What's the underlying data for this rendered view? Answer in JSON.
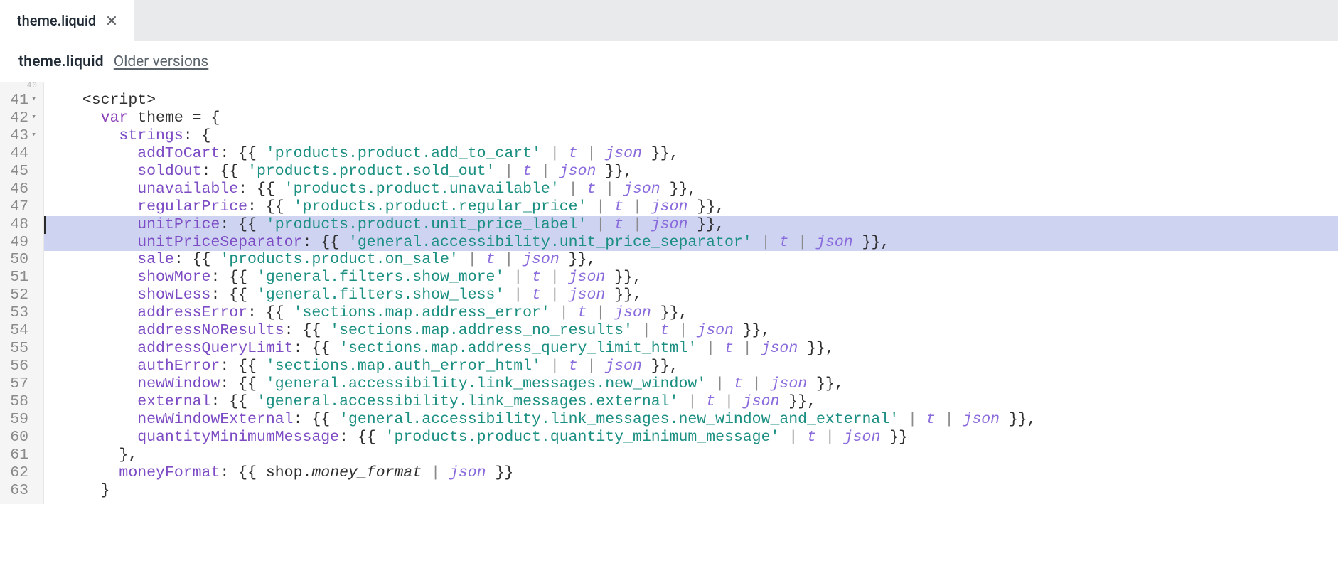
{
  "tab": {
    "label": "theme.liquid"
  },
  "header": {
    "title": "theme.liquid",
    "older_versions": "Older versions"
  },
  "gutter": {
    "ghost_prev": "40",
    "lines": [
      {
        "n": "41",
        "fold": true
      },
      {
        "n": "42",
        "fold": true
      },
      {
        "n": "43",
        "fold": true
      },
      {
        "n": "44",
        "fold": false
      },
      {
        "n": "45",
        "fold": false
      },
      {
        "n": "46",
        "fold": false
      },
      {
        "n": "47",
        "fold": false
      },
      {
        "n": "48",
        "fold": false
      },
      {
        "n": "49",
        "fold": false
      },
      {
        "n": "50",
        "fold": false
      },
      {
        "n": "51",
        "fold": false
      },
      {
        "n": "52",
        "fold": false
      },
      {
        "n": "53",
        "fold": false
      },
      {
        "n": "54",
        "fold": false
      },
      {
        "n": "55",
        "fold": false
      },
      {
        "n": "56",
        "fold": false
      },
      {
        "n": "57",
        "fold": false
      },
      {
        "n": "58",
        "fold": false
      },
      {
        "n": "59",
        "fold": false
      },
      {
        "n": "60",
        "fold": false
      },
      {
        "n": "61",
        "fold": false
      },
      {
        "n": "62",
        "fold": false
      },
      {
        "n": "63",
        "fold": false
      }
    ]
  },
  "code": {
    "highlighted_rows": [
      7,
      8
    ],
    "cursor_row": 7,
    "lines": [
      {
        "indent": 1,
        "type": "raw",
        "text": "<script>"
      },
      {
        "indent": 2,
        "type": "vardecl",
        "kw": "var",
        "name": "theme",
        "eq": " = {"
      },
      {
        "indent": 3,
        "type": "raw2",
        "prop": "strings",
        "rest": ": {"
      },
      {
        "indent": 4,
        "type": "prop",
        "prop": "addToCart",
        "str": "'products.product.add_to_cart'",
        "filters": [
          "t",
          "json"
        ],
        "trail": "}},"
      },
      {
        "indent": 4,
        "type": "prop",
        "prop": "soldOut",
        "str": "'products.product.sold_out'",
        "filters": [
          "t",
          "json"
        ],
        "trail": "}},"
      },
      {
        "indent": 4,
        "type": "prop",
        "prop": "unavailable",
        "str": "'products.product.unavailable'",
        "filters": [
          "t",
          "json"
        ],
        "trail": "}},"
      },
      {
        "indent": 4,
        "type": "prop",
        "prop": "regularPrice",
        "str": "'products.product.regular_price'",
        "filters": [
          "t",
          "json"
        ],
        "trail": "}},"
      },
      {
        "indent": 4,
        "type": "prop",
        "prop": "unitPrice",
        "str": "'products.product.unit_price_label'",
        "filters": [
          "t",
          "json"
        ],
        "trail": "}},"
      },
      {
        "indent": 4,
        "type": "prop",
        "prop": "unitPriceSeparator",
        "str": "'general.accessibility.unit_price_separator'",
        "filters": [
          "t",
          "json"
        ],
        "trail": "}},"
      },
      {
        "indent": 4,
        "type": "prop",
        "prop": "sale",
        "str": "'products.product.on_sale'",
        "filters": [
          "t",
          "json"
        ],
        "trail": "}},"
      },
      {
        "indent": 4,
        "type": "prop",
        "prop": "showMore",
        "str": "'general.filters.show_more'",
        "filters": [
          "t",
          "json"
        ],
        "trail": "}},"
      },
      {
        "indent": 4,
        "type": "prop",
        "prop": "showLess",
        "str": "'general.filters.show_less'",
        "filters": [
          "t",
          "json"
        ],
        "trail": "}},"
      },
      {
        "indent": 4,
        "type": "prop",
        "prop": "addressError",
        "str": "'sections.map.address_error'",
        "filters": [
          "t",
          "json"
        ],
        "trail": "}},"
      },
      {
        "indent": 4,
        "type": "prop",
        "prop": "addressNoResults",
        "str": "'sections.map.address_no_results'",
        "filters": [
          "t",
          "json"
        ],
        "trail": "}},"
      },
      {
        "indent": 4,
        "type": "prop",
        "prop": "addressQueryLimit",
        "str": "'sections.map.address_query_limit_html'",
        "filters": [
          "t",
          "json"
        ],
        "trail": "}},"
      },
      {
        "indent": 4,
        "type": "prop",
        "prop": "authError",
        "str": "'sections.map.auth_error_html'",
        "filters": [
          "t",
          "json"
        ],
        "trail": "}},"
      },
      {
        "indent": 4,
        "type": "prop",
        "prop": "newWindow",
        "str": "'general.accessibility.link_messages.new_window'",
        "filters": [
          "t",
          "json"
        ],
        "trail": "}},"
      },
      {
        "indent": 4,
        "type": "prop",
        "prop": "external",
        "str": "'general.accessibility.link_messages.external'",
        "filters": [
          "t",
          "json"
        ],
        "trail": "}},"
      },
      {
        "indent": 4,
        "type": "prop",
        "prop": "newWindowExternal",
        "str": "'general.accessibility.link_messages.new_window_and_external'",
        "filters": [
          "t",
          "json"
        ],
        "trail": "}},"
      },
      {
        "indent": 4,
        "type": "prop",
        "prop": "quantityMinimumMessage",
        "str": "'products.product.quantity_minimum_message'",
        "filters": [
          "t",
          "json"
        ],
        "trail": "}}"
      },
      {
        "indent": 3,
        "type": "raw",
        "text": "},"
      },
      {
        "indent": 3,
        "type": "money",
        "prop": "moneyFormat",
        "obj": "shop.",
        "field": "money_format",
        "filters": [
          "json"
        ],
        "trail": "}}"
      },
      {
        "indent": 2,
        "type": "raw",
        "text": "}"
      }
    ]
  }
}
